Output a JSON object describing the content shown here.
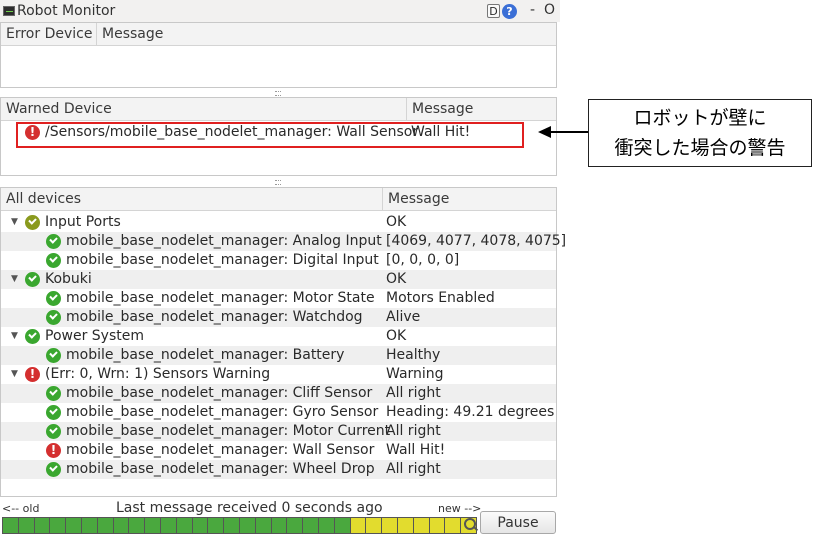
{
  "window": {
    "title": "Robot Monitor",
    "btn_d": "D",
    "btn_help": "?",
    "btn_min": "-",
    "btn_close": "O"
  },
  "error_pane": {
    "col_device": "Error Device",
    "col_message": "Message"
  },
  "warn_pane": {
    "col_device": "Warned Device",
    "col_message": "Message",
    "rows": [
      {
        "name": "/Sensors/mobile_base_nodelet_manager: Wall Sensor",
        "message": "Wall Hit!",
        "status": "error"
      }
    ]
  },
  "all_pane": {
    "col_device": "All devices",
    "col_message": "Message",
    "rows": [
      {
        "level": 0,
        "name": "Input Ports",
        "message": "OK",
        "status": "ok-olive"
      },
      {
        "level": 1,
        "name": "mobile_base_nodelet_manager: Analog Input",
        "message": "[4069, 4077, 4078, 4075]",
        "status": "ok"
      },
      {
        "level": 1,
        "name": "mobile_base_nodelet_manager: Digital Input",
        "message": "[0, 0, 0, 0]",
        "status": "ok"
      },
      {
        "level": 0,
        "name": "Kobuki",
        "message": "OK",
        "status": "ok"
      },
      {
        "level": 1,
        "name": "mobile_base_nodelet_manager: Motor State",
        "message": "Motors Enabled",
        "status": "ok"
      },
      {
        "level": 1,
        "name": "mobile_base_nodelet_manager: Watchdog",
        "message": "Alive",
        "status": "ok"
      },
      {
        "level": 0,
        "name": "Power System",
        "message": "OK",
        "status": "ok"
      },
      {
        "level": 1,
        "name": "mobile_base_nodelet_manager: Battery",
        "message": "Healthy",
        "status": "ok"
      },
      {
        "level": 0,
        "name": "(Err: 0, Wrn: 1) Sensors Warning",
        "message": "Warning",
        "status": "error"
      },
      {
        "level": 1,
        "name": "mobile_base_nodelet_manager: Cliff Sensor",
        "message": "All right",
        "status": "ok"
      },
      {
        "level": 1,
        "name": "mobile_base_nodelet_manager: Gyro Sensor",
        "message": "Heading: 49.21 degrees",
        "status": "ok"
      },
      {
        "level": 1,
        "name": "mobile_base_nodelet_manager: Motor Current",
        "message": "All right",
        "status": "ok"
      },
      {
        "level": 1,
        "name": "mobile_base_nodelet_manager: Wall Sensor",
        "message": "Wall Hit!",
        "status": "error"
      },
      {
        "level": 1,
        "name": "mobile_base_nodelet_manager: Wheel Drop",
        "message": "All right",
        "status": "ok"
      }
    ]
  },
  "callout": {
    "line1": "ロボットが壁に",
    "line2": "衝突した場合の警告"
  },
  "footer": {
    "old_label": "<-- old",
    "status": "Last message received 0 seconds ago",
    "new_label": "new -->",
    "pause_label": "Pause",
    "timeline": [
      "g",
      "g",
      "g",
      "g",
      "g",
      "g",
      "g",
      "g",
      "g",
      "g",
      "g",
      "g",
      "g",
      "g",
      "g",
      "g",
      "g",
      "g",
      "g",
      "g",
      "g",
      "g",
      "y",
      "y",
      "y",
      "y",
      "y",
      "y",
      "y",
      "y"
    ]
  },
  "colors": {
    "ok": "#3aa72f",
    "error": "#d42f2f",
    "highlight": "#e02020",
    "timeline_green": "#4aa83e",
    "timeline_yellow": "#e2dc2e"
  }
}
